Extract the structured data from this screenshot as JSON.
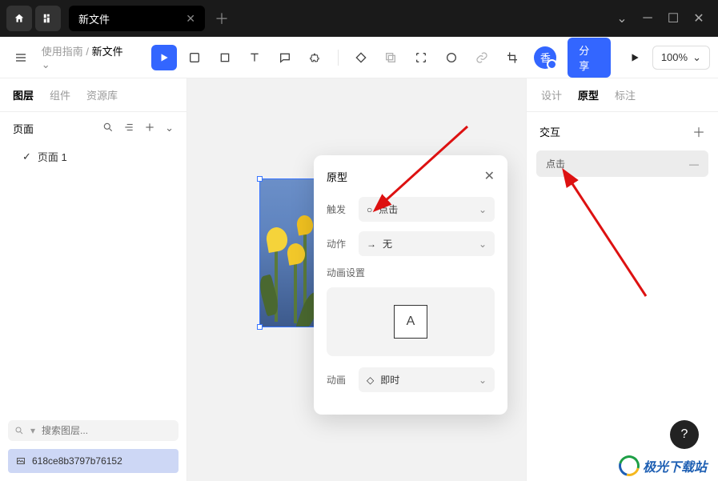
{
  "titlebar": {
    "tab_name": "新文件"
  },
  "toolbar": {
    "crumb_parent": "使用指南",
    "crumb_sep": " / ",
    "crumb_current": "新文件",
    "avatar_char": "香",
    "share_label": "分享",
    "zoom_label": "100%"
  },
  "left": {
    "tabs": [
      "图层",
      "组件",
      "资源库"
    ],
    "pages_label": "页面",
    "page_items": [
      "页面 1"
    ],
    "search_placeholder": "搜索图层...",
    "layer_name": "618ce8b3797b76152"
  },
  "popup": {
    "title": "原型",
    "trigger_label": "触发",
    "trigger_value": "点击",
    "action_label": "动作",
    "action_value": "无",
    "anim_section": "动画设置",
    "anim_char": "A",
    "anim_label": "动画",
    "anim_value": "即时"
  },
  "right": {
    "tabs": [
      "设计",
      "原型",
      "标注"
    ],
    "interact_label": "交互",
    "item_value": "点击"
  },
  "watermark": "极光下载站"
}
